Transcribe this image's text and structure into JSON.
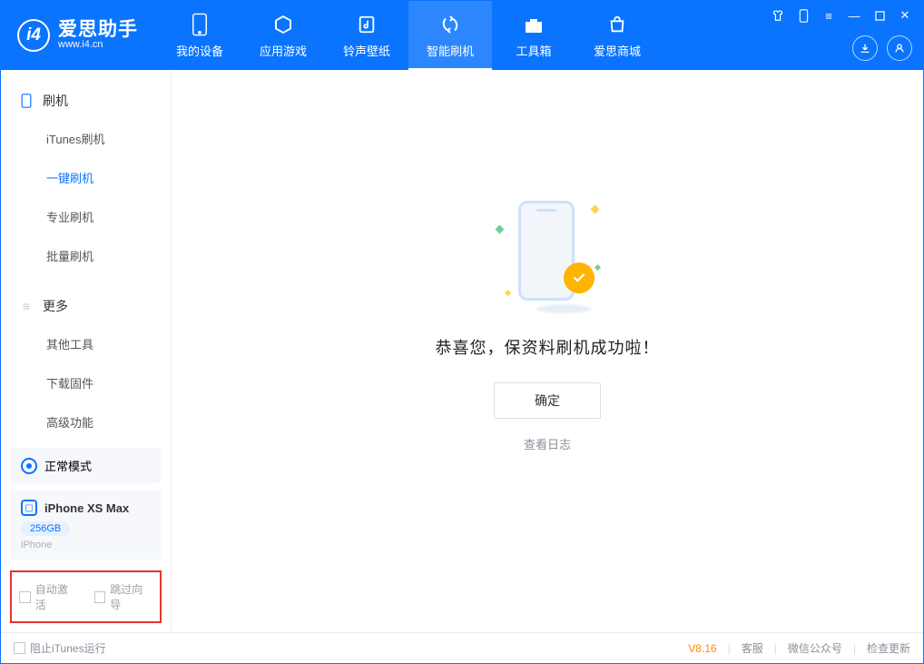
{
  "app": {
    "title": "爱思助手",
    "subtitle": "www.i4.cn"
  },
  "nav": {
    "tabs": [
      {
        "label": "我的设备",
        "icon": "device-icon"
      },
      {
        "label": "应用游戏",
        "icon": "cube-icon"
      },
      {
        "label": "铃声壁纸",
        "icon": "note-icon"
      },
      {
        "label": "智能刷机",
        "icon": "refresh-icon"
      },
      {
        "label": "工具箱",
        "icon": "toolbox-icon"
      },
      {
        "label": "爱思商城",
        "icon": "bag-icon"
      }
    ],
    "active_index": 3
  },
  "sidebar": {
    "groups": [
      {
        "title": "刷机",
        "icon": "phone-outline-icon",
        "items": [
          {
            "label": "iTunes刷机"
          },
          {
            "label": "一键刷机"
          },
          {
            "label": "专业刷机"
          },
          {
            "label": "批量刷机"
          }
        ],
        "selected_index": 1
      },
      {
        "title": "更多",
        "icon": "menu-icon",
        "items": [
          {
            "label": "其他工具"
          },
          {
            "label": "下载固件"
          },
          {
            "label": "高级功能"
          }
        ],
        "selected_index": -1
      }
    ],
    "mode_card": {
      "label": "正常模式"
    },
    "device_card": {
      "name": "iPhone XS Max",
      "capacity": "256GB",
      "type": "iPhone"
    },
    "checks": {
      "auto_activate": "自动激活",
      "skip_guide": "跳过向导"
    }
  },
  "main": {
    "success_msg": "恭喜您，保资料刷机成功啦！",
    "ok_button": "确定",
    "view_log": "查看日志"
  },
  "statusbar": {
    "block_itunes": "阻止iTunes运行",
    "version": "V8.16",
    "links": {
      "support": "客服",
      "wechat": "微信公众号",
      "check_update": "检查更新"
    }
  }
}
